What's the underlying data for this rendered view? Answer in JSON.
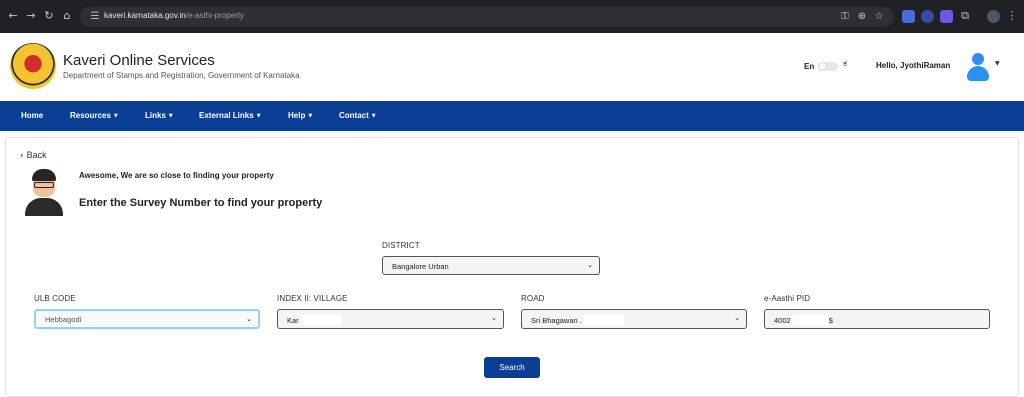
{
  "browser": {
    "url_host": "kaveri.karnataka.gov.in",
    "url_path": "/e-asthi-property",
    "nav_icons": [
      "back-arrow-icon",
      "forward-arrow-icon",
      "reload-icon",
      "home-icon"
    ],
    "right_icons": [
      "password-key-icon",
      "zoom-icon",
      "bookmark-star-icon"
    ]
  },
  "header": {
    "title": "Kaveri Online Services",
    "subtitle": "Department of Stamps and Registration, Government of Karnataka",
    "lang_en": "En",
    "lang_kn": "ಕ",
    "greeting": "Hello, JyothiRaman",
    "brand_color": "#0b3f95"
  },
  "nav": {
    "items": [
      {
        "label": "Home",
        "dropdown": false
      },
      {
        "label": "Resources",
        "dropdown": true
      },
      {
        "label": "Links",
        "dropdown": true
      },
      {
        "label": "External Links",
        "dropdown": true
      },
      {
        "label": "Help",
        "dropdown": true
      },
      {
        "label": "Contact",
        "dropdown": true
      }
    ]
  },
  "main": {
    "back_label": "Back",
    "message_small": "Awesome, We are so close to finding your property",
    "message_large": "Enter the Survey Number to find your property",
    "district": {
      "label": "DISTRICT",
      "value": "Bangalore Urban"
    },
    "ulb_code": {
      "label": "ULB CODE",
      "value": "Hebbagodi"
    },
    "village": {
      "label": "INDEX II: VILLAGE",
      "value": "Kar"
    },
    "road": {
      "label": "ROAD",
      "value": "Sri Bhagawan ."
    },
    "pid": {
      "label": "e-Aasthi PID",
      "value": "4002",
      "suffix": "$"
    },
    "search_label": "Search"
  }
}
